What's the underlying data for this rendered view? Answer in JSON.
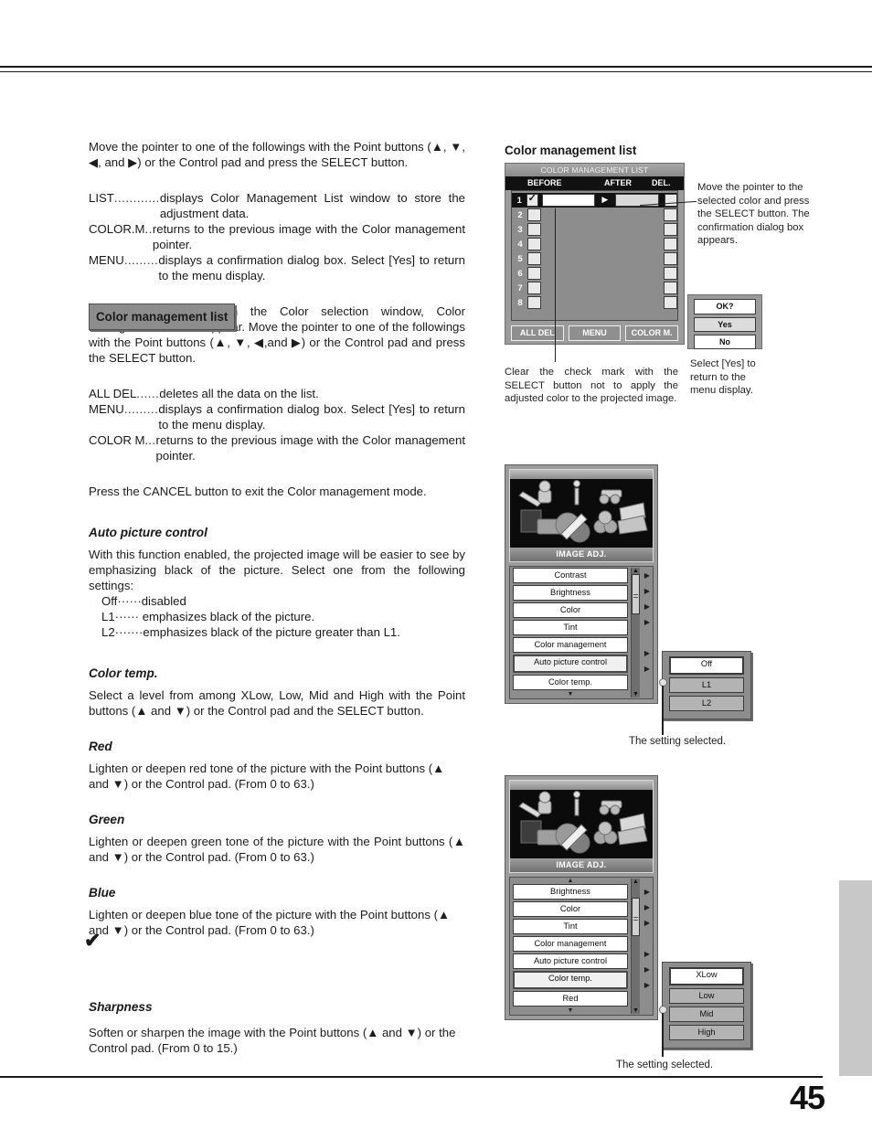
{
  "page": {
    "number": "45"
  },
  "left": {
    "intro": "Move the pointer to one of the followings with the Point buttons (▲, ▼, ◀, and ▶) or the Control pad and press the SELECT button.",
    "defs1": [
      {
        "term": "LIST",
        "dots": "............",
        "desc": "displays Color Management List window to store the adjustment data."
      },
      {
        "term": "COLOR.M",
        "dots": "..",
        "desc": "returns to the previous image with the Color management pointer."
      },
      {
        "term": "MENU",
        "dots": ".........",
        "desc": "displays a confirmation dialog box. Select [Yes] to return to the menu display."
      }
    ],
    "cml_heading": "Color management list",
    "cml_body": "After selecting LIST on the Color selection window, Color Management List will appear. Move the pointer to one of the followings with the Point buttons (▲, ▼, ◀,and ▶) or the Control pad and press the SELECT button.",
    "defs2": [
      {
        "term": "ALL DEL",
        "dots": "......",
        "desc": "deletes all the data on the list."
      },
      {
        "term": "MENU",
        "dots": ".........",
        "desc": "displays a confirmation dialog box. Select [Yes] to return to the menu display."
      },
      {
        "term": "COLOR M.",
        "dots": "..",
        "desc": "returns to the previous image with the Color management pointer."
      }
    ],
    "cancel_note": "Press the CANCEL button to exit the Color management mode.",
    "auto_picture": {
      "heading": "Auto picture control",
      "body": "With this function enabled, the projected image will be easier to see by emphasizing black of the picture. Select one from the following settings:",
      "options": [
        {
          "name": "Off",
          "dots": "······",
          "desc": "disabled"
        },
        {
          "name": "L1",
          "dots": "······",
          "desc": " emphasizes black of the picture."
        },
        {
          "name": "L2",
          "dots": "·······",
          "desc": "emphasizes black of the picture greater than L1."
        }
      ]
    },
    "color_temp": {
      "heading": "Color temp.",
      "body": "Select a level from among XLow, Low, Mid and High with the Point  buttons (▲ and ▼) or the Control pad and the SELECT button."
    },
    "red": {
      "heading": "Red",
      "body": "Lighten or deepen red tone of the picture with the Point buttons (▲ and ▼) or the Control pad. (From 0 to 63.)"
    },
    "green": {
      "heading": "Green",
      "body": "Lighten or deepen green tone of the picture with the Point buttons (▲ and ▼) or the Control pad. (From 0 to 63.)"
    },
    "blue": {
      "heading": "Blue",
      "body": "Lighten or deepen blue tone of the picture with the Point buttons (▲ and ▼) or the Control pad. (From 0 to 63.)"
    },
    "check_glyph": "✔",
    "sharpness": {
      "heading": "Sharpness",
      "body": "Soften or sharpen the image with the Point buttons (▲ and ▼) or the Control pad. (From 0 to 15.)"
    }
  },
  "right": {
    "cml_heading": "Color management list",
    "cml_window": {
      "title": "COLOR MANAGEMENT LIST",
      "columns": {
        "before": "BEFORE",
        "after": "AFTER",
        "del": "DEL."
      },
      "rows": [
        {
          "index": "1",
          "checked": true,
          "active": true
        },
        {
          "index": "2",
          "checked": false,
          "active": false
        },
        {
          "index": "3",
          "checked": false,
          "active": false
        },
        {
          "index": "4",
          "checked": false,
          "active": false
        },
        {
          "index": "5",
          "checked": false,
          "active": false
        },
        {
          "index": "6",
          "checked": false,
          "active": false
        },
        {
          "index": "7",
          "checked": false,
          "active": false
        },
        {
          "index": "8",
          "checked": false,
          "active": false
        }
      ],
      "check_glyph": "✓",
      "arrow_glyph": "▶",
      "buttons": [
        "ALL DEL",
        "MENU",
        "COLOR M."
      ]
    },
    "note_pointer": "Move the pointer to the selected color and press the SELECT button. The confirmation dialog box appears.",
    "ok_dialog": {
      "question": "OK?",
      "yes": "Yes",
      "no": "No"
    },
    "note_yes": "Select [Yes] to return to the menu display.",
    "note_clear": "Clear the check mark with the SELECT button not to apply the adjusted color to the projected image.",
    "osd_auto": {
      "menu_title": "IMAGE ADJ.",
      "items": [
        {
          "label": "Contrast",
          "selected": false,
          "arrow": true
        },
        {
          "label": "Brightness",
          "selected": false,
          "arrow": true
        },
        {
          "label": "Color",
          "selected": false,
          "arrow": true
        },
        {
          "label": "Tint",
          "selected": false,
          "arrow": true
        },
        {
          "label": "Color management",
          "selected": false,
          "arrow": false
        },
        {
          "label": "Auto picture control",
          "selected": true,
          "arrow": true
        },
        {
          "label": "Color temp.",
          "selected": false,
          "arrow": true
        }
      ],
      "submenu": [
        {
          "label": "Off",
          "selected": true
        },
        {
          "label": "L1",
          "selected": false
        },
        {
          "label": "L2",
          "selected": false
        }
      ],
      "caption": "The setting selected."
    },
    "osd_temp": {
      "menu_title": "IMAGE ADJ.",
      "items": [
        {
          "label": "Brightness",
          "selected": false,
          "arrow": true
        },
        {
          "label": "Color",
          "selected": false,
          "arrow": true
        },
        {
          "label": "Tint",
          "selected": false,
          "arrow": true
        },
        {
          "label": "Color management",
          "selected": false,
          "arrow": false
        },
        {
          "label": "Auto picture control",
          "selected": false,
          "arrow": true
        },
        {
          "label": "Color temp.",
          "selected": true,
          "arrow": true
        },
        {
          "label": "Red",
          "selected": false,
          "arrow": true
        }
      ],
      "submenu": [
        {
          "label": "XLow",
          "selected": true
        },
        {
          "label": "Low",
          "selected": false
        },
        {
          "label": "Mid",
          "selected": false
        },
        {
          "label": "High",
          "selected": false
        }
      ],
      "caption": "The setting selected."
    }
  }
}
